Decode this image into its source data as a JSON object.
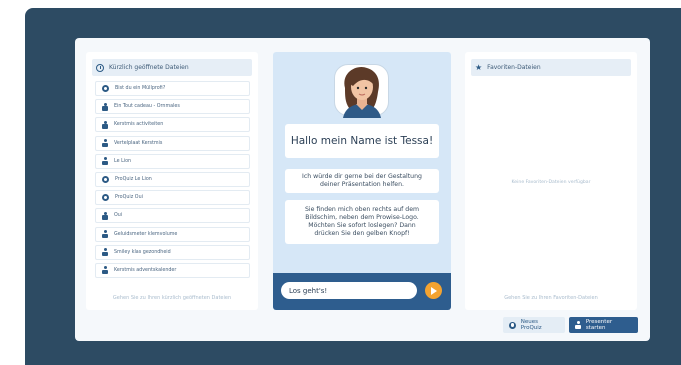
{
  "recent": {
    "header": "Kürzlich geöffnete Dateien",
    "items": [
      {
        "icon": "quiz-icon",
        "label": "Bist du ein Müllprofi?"
      },
      {
        "icon": "presentation-icon",
        "label": "Ein Tout cadeau - Ornmales"
      },
      {
        "icon": "presentation-icon",
        "label": "Kerstmis activiteiten"
      },
      {
        "icon": "presentation-icon",
        "label": "Vertelplaat Kerstmis"
      },
      {
        "icon": "presentation-icon",
        "label": "Le Lion"
      },
      {
        "icon": "quiz-icon",
        "label": "ProQuiz Le Lion"
      },
      {
        "icon": "quiz-icon",
        "label": "ProQuiz Oui"
      },
      {
        "icon": "presentation-icon",
        "label": "Oui"
      },
      {
        "icon": "presentation-icon",
        "label": "Geluidsmeter klemvolume"
      },
      {
        "icon": "presentation-icon",
        "label": "Smiley klas gezondheid"
      },
      {
        "icon": "presentation-icon",
        "label": "Kerstmis adventskalender"
      }
    ],
    "footer": "Gehen Sie zu Ihren kürzlich geöffneten Dateien"
  },
  "chat": {
    "greeting": "Hallo mein Name ist Tessa!",
    "message1": "Ich würde dir gerne bei der Gestaltung deiner Präsentation helfen.",
    "message2": "Sie finden mich oben rechts auf dem Bildschim, neben dem Prowise-Logo. Möchten Sie sofort loslegen? Dann drücken Sie den gelben Knopf!",
    "input_value": "Los geht's!"
  },
  "favorites": {
    "header": "Favoriten-Dateien",
    "empty": "Keine Favoriten-Dateien verfügbar",
    "footer": "Gehen Sie zu Ihren Favoriten-Dateien"
  },
  "buttons": {
    "new_quiz": "Neues ProQuiz",
    "start_presenter": "Presenter starten"
  },
  "colors": {
    "backdrop": "#2d4b63",
    "accent": "#2e5d8e",
    "send": "#f3a331",
    "chat_bg": "#d6e7f7"
  }
}
